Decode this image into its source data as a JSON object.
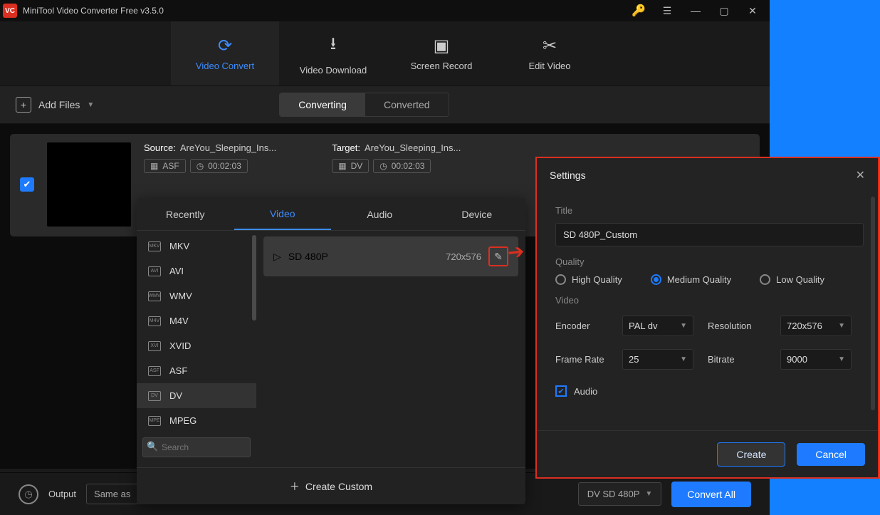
{
  "app": {
    "title": "MiniTool Video Converter Free v3.5.0"
  },
  "mainTabs": [
    "Video Convert",
    "Video Download",
    "Screen Record",
    "Edit Video"
  ],
  "toolbar": {
    "addFiles": "Add Files",
    "converting": "Converting",
    "converted": "Converted"
  },
  "job": {
    "source_label": "Source:",
    "source": "AreYou_Sleeping_Ins...",
    "target_label": "Target:",
    "target": "AreYou_Sleeping_Ins...",
    "container_src": "ASF",
    "container_tgt": "DV",
    "duration": "00:02:03"
  },
  "formatPanel": {
    "tabs": [
      "Recently",
      "Video",
      "Audio",
      "Device"
    ],
    "sideItems": [
      "MKV",
      "AVI",
      "WMV",
      "M4V",
      "XVID",
      "ASF",
      "DV",
      "MPEG"
    ],
    "selectedSide": "DV",
    "preset": {
      "name": "SD 480P",
      "res": "720x576"
    },
    "search_placeholder": "Search",
    "createCustom": "Create Custom"
  },
  "bottom": {
    "output_label": "Output",
    "output_value": "Same as",
    "target_value": "DV SD 480P",
    "convert_all": "Convert All"
  },
  "settingsDlg": {
    "title": "Settings",
    "section_title": "Title",
    "title_value": "SD 480P_Custom",
    "quality_label": "Quality",
    "quality_options": [
      "High Quality",
      "Medium Quality",
      "Low Quality"
    ],
    "quality_selected": "Medium Quality",
    "video_label": "Video",
    "encoder_label": "Encoder",
    "encoder": "PAL dv",
    "resolution_label": "Resolution",
    "resolution": "720x576",
    "framerate_label": "Frame Rate",
    "framerate": "25",
    "bitrate_label": "Bitrate",
    "bitrate": "9000",
    "audio_label": "Audio",
    "create": "Create",
    "cancel": "Cancel"
  }
}
